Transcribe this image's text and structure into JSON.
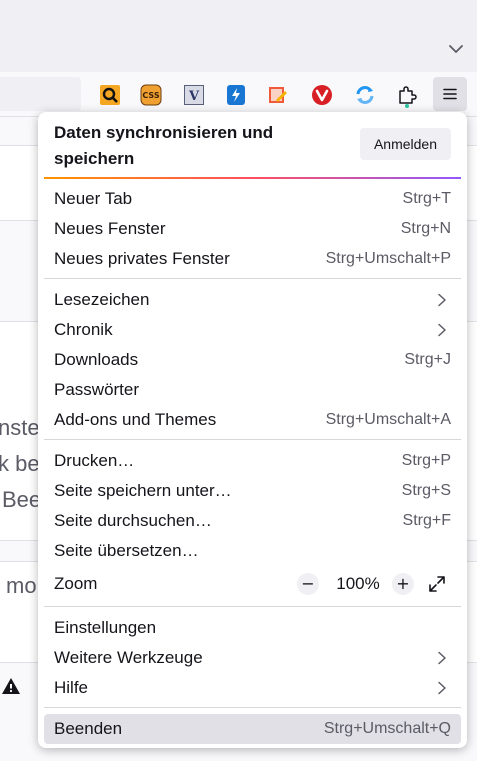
{
  "page": {
    "fragments": [
      "nste",
      "k be",
      "Bee",
      "mo"
    ]
  },
  "panel": {
    "sync": {
      "title": "Daten synchronisieren und speichern",
      "signin": "Anmelden"
    },
    "groups": [
      [
        {
          "label": "Neuer Tab",
          "shortcut": "Strg+T"
        },
        {
          "label": "Neues Fenster",
          "shortcut": "Strg+N"
        },
        {
          "label": "Neues privates Fenster",
          "shortcut": "Strg+Umschalt+P"
        }
      ],
      [
        {
          "label": "Lesezeichen",
          "submenu": true
        },
        {
          "label": "Chronik",
          "submenu": true
        },
        {
          "label": "Downloads",
          "shortcut": "Strg+J"
        },
        {
          "label": "Passwörter"
        },
        {
          "label": "Add-ons und Themes",
          "shortcut": "Strg+Umschalt+A"
        }
      ],
      [
        {
          "label": "Drucken…",
          "shortcut": "Strg+P"
        },
        {
          "label": "Seite speichern unter…",
          "shortcut": "Strg+S"
        },
        {
          "label": "Seite durchsuchen…",
          "shortcut": "Strg+F"
        },
        {
          "label": "Seite übersetzen…"
        }
      ],
      [
        {
          "label": "Einstellungen"
        },
        {
          "label": "Weitere Werkzeuge",
          "submenu": true
        },
        {
          "label": "Hilfe",
          "submenu": true
        }
      ],
      [
        {
          "label": "Beenden",
          "shortcut": "Strg+Umschalt+Q",
          "active": true
        }
      ]
    ],
    "zoom": {
      "label": "Zoom",
      "minus": "−",
      "value": "100%",
      "plus": "+"
    }
  },
  "toolbar": {
    "extensions": [
      {
        "name": "magnifier-extension-icon",
        "color": "#f5a623"
      },
      {
        "name": "css-extension-icon",
        "color": "#f0a030",
        "text": "CSS"
      },
      {
        "name": "v-extension-icon",
        "color": "#d8dbe6",
        "text": "V"
      },
      {
        "name": "lightning-extension-icon",
        "color": "#1976d2"
      },
      {
        "name": "edit-extension-icon",
        "color": "#ef5b3a"
      },
      {
        "name": "vivaldi-extension-icon",
        "color": "#d81f26"
      },
      {
        "name": "sync-extension-icon",
        "color": "#2196f3"
      },
      {
        "name": "puzzle-extensions-icon",
        "color": "#15141a"
      }
    ]
  },
  "colors": {
    "accent_gradient": [
      "#ff9400",
      "#ff4f5e",
      "#9059ff"
    ],
    "panel_bg": "#ffffff",
    "active_item_bg": "#e0e0e6"
  }
}
